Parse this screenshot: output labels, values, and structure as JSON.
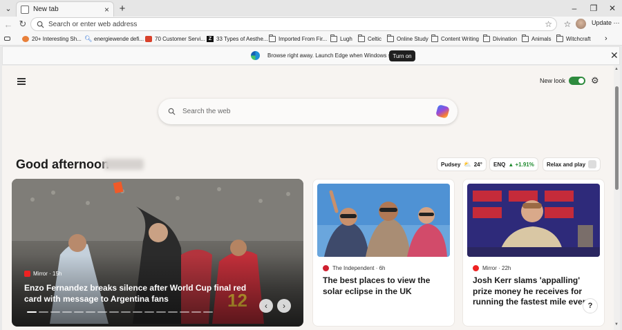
{
  "tabs": [
    {
      "title": "New tab"
    }
  ],
  "address": {
    "placeholder": "Search or enter web address"
  },
  "toolbar": {
    "update_label": "Update"
  },
  "bookmarks": [
    {
      "label": "20+ Interesting Sh...",
      "icon": "bookmark-favicon"
    },
    {
      "label": "energiewende defi...",
      "icon": "search-favicon"
    },
    {
      "label": "70 Customer Servi...",
      "icon": "bookmark-favicon"
    },
    {
      "label": "33 Types of Aesthe...",
      "icon": "z-favicon"
    },
    {
      "label": "Imported From Fir...",
      "icon": "folder-icon"
    },
    {
      "label": "Lugh",
      "icon": "folder-icon"
    },
    {
      "label": "Celtic",
      "icon": "folder-icon"
    },
    {
      "label": "Online Study",
      "icon": "folder-icon"
    },
    {
      "label": "Content Writing",
      "icon": "folder-icon"
    },
    {
      "label": "Divination",
      "icon": "folder-icon"
    },
    {
      "label": "Animals",
      "icon": "folder-icon"
    },
    {
      "label": "Witchcraft",
      "icon": "folder-icon"
    }
  ],
  "infobar": {
    "message": "Browse right away. Launch Edge when Windows starts.",
    "button": "Turn on"
  },
  "ntp": {
    "new_look": "New look",
    "search_placeholder": "Search the web",
    "greeting": "Good afternoon",
    "chips": {
      "weather_city": "Pudsey",
      "weather_temp": "24°",
      "stock_symbol": "ENQ",
      "stock_change": "▲ +1.91%",
      "play": "Relax and play"
    },
    "hero": {
      "source": "Mirror · 15h",
      "headline": "Enzo Fernandez breaks silence after World Cup final red card with message to Argentina fans"
    },
    "cards": [
      {
        "source": "The Independent · 6h",
        "headline": "The best places to view the solar eclipse in the UK"
      },
      {
        "source": "Mirror · 22h",
        "headline": "Josh Kerr slams 'appalling' prize money he receives for running the fastest mile ever"
      }
    ],
    "help": "?"
  },
  "colors": {
    "toggle_on": "#2e8b3e",
    "stock_up": "#1f8a2e",
    "turn_on_bg": "#1f1f1f"
  }
}
